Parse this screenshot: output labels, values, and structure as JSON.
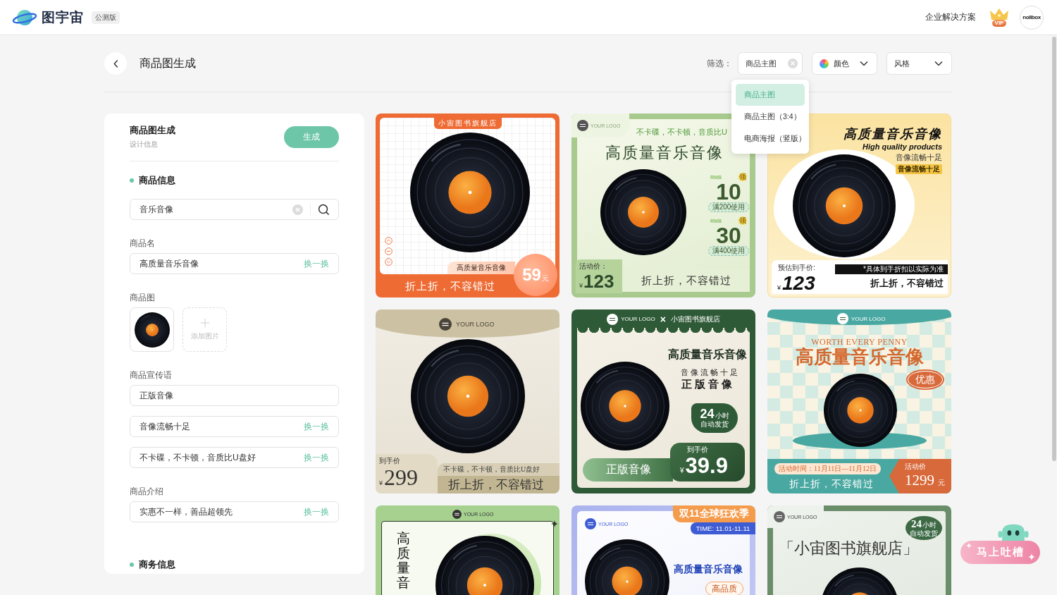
{
  "header": {
    "brand": "图宇宙",
    "badge": "公测版",
    "enterprise_link": "企业解决方案",
    "vip_label": "VIP",
    "avatar_label": "nolibox"
  },
  "toolbar": {
    "title": "商品图生成",
    "filter_label": "筛选：",
    "filters": [
      {
        "kind": "chip",
        "label": "商品主图"
      },
      {
        "kind": "color",
        "label": "颜色"
      },
      {
        "kind": "plain",
        "label": "风格"
      }
    ]
  },
  "dropdown_menu": {
    "items": [
      {
        "label": "商品主图",
        "selected": true
      },
      {
        "label": "商品主图（3:4）",
        "selected": false
      },
      {
        "label": "电商海报（竖版）",
        "selected": false
      }
    ]
  },
  "form": {
    "title": "商品图生成",
    "subtitle": "设计信息",
    "submit_label": "生成",
    "sections": [
      {
        "title": "商品信息",
        "items": [
          {
            "kind": "search",
            "value": "音乐音像"
          },
          {
            "kind": "label",
            "text": "商品名"
          },
          {
            "kind": "input",
            "value": "高质量音乐音像",
            "action": "换一换"
          },
          {
            "kind": "label",
            "text": "商品图"
          },
          {
            "kind": "images",
            "add_label": "添加图片"
          },
          {
            "kind": "label",
            "text": "商品宣传语"
          },
          {
            "kind": "input",
            "value": "正版音像"
          },
          {
            "kind": "input",
            "value": "音像流畅十足",
            "action": "换一换"
          },
          {
            "kind": "input",
            "value": "不卡碟，不卡顿，音质比U盘好",
            "action": "换一换"
          },
          {
            "kind": "label",
            "text": "商品介绍"
          },
          {
            "kind": "input",
            "value": "实惠不一样，善品超领先",
            "action": "换一换"
          }
        ]
      },
      {
        "title": "商务信息"
      }
    ]
  },
  "cards": [
    {
      "kind": "orange",
      "store": "小宙图书旗舰店",
      "title": "高质量音乐音像",
      "slogan": "折上折，不容错过",
      "price": "59",
      "unit": "元"
    },
    {
      "kind": "green",
      "logo": "YOUR LOGO",
      "headline": "不卡碟，不卡顿，音质比U",
      "title": "高质量音乐音像",
      "coupons": [
        {
          "currency": "RMB",
          "badge": "领",
          "amount": "10",
          "condition": "满200使用"
        },
        {
          "currency": "RMB",
          "badge": "领",
          "amount": "30",
          "condition": "满400使用"
        }
      ],
      "price_label": "活动价：",
      "currency": "¥",
      "price": "123",
      "slogan": "折上折，不容错过"
    },
    {
      "kind": "yellow",
      "title": "高质量音乐音像",
      "subtitle": "High quality products",
      "line": "音像流畅十足",
      "tag": "音像流畅十足",
      "price_label": "预估到手价:",
      "note": "*具体到手折扣以实际为准",
      "currency": "¥",
      "price": "123",
      "slogan": "折上折，不容错过"
    },
    {
      "kind": "beige",
      "logo": "YOUR LOGO",
      "price_label": "到手价",
      "currency": "¥",
      "price": "299",
      "line": "不卡碟，不卡顿，音质比U盘好",
      "slogan": "折上折，不容错过"
    },
    {
      "kind": "forest",
      "logo": "YOUR LOGO",
      "separator": "×",
      "store": "小宙图书旗舰店",
      "title": "高质量音乐音像",
      "lines": [
        "音像流畅十足",
        "正版音像"
      ],
      "badge_number": "24",
      "badge_unit": "小时",
      "badge_text": "自动发货",
      "tag": "正版音像",
      "price_label": "到手价",
      "currency": "¥",
      "price": "39.9"
    },
    {
      "kind": "teal",
      "logo": "YOUR LOGO",
      "eyebrow": "WORTH EVERY PENNY",
      "title": "高质量音乐音像",
      "badge": "优惠",
      "date": "活动时间：11月11日—11月12日",
      "slogan": "折上折，不容错过",
      "price_label": "活动价",
      "price": "1299",
      "unit": "元"
    },
    {
      "kind": "mint",
      "logo": "YOUR LOGO",
      "title": "高质量音"
    },
    {
      "kind": "blue",
      "logo": "YOUR LOGO",
      "banner": "双11全球狂欢季",
      "time": "TIME: 11.01-11.11",
      "title": "高质量音乐音像",
      "tag": "高品质"
    },
    {
      "kind": "sage",
      "logo": "YOUR LOGO",
      "badge_number": "24",
      "badge_unit": "小时",
      "badge_text": "自动发货",
      "title": "「小宙图书旗舰店」"
    }
  ],
  "feedback_button": {
    "label": "马上吐槽"
  }
}
